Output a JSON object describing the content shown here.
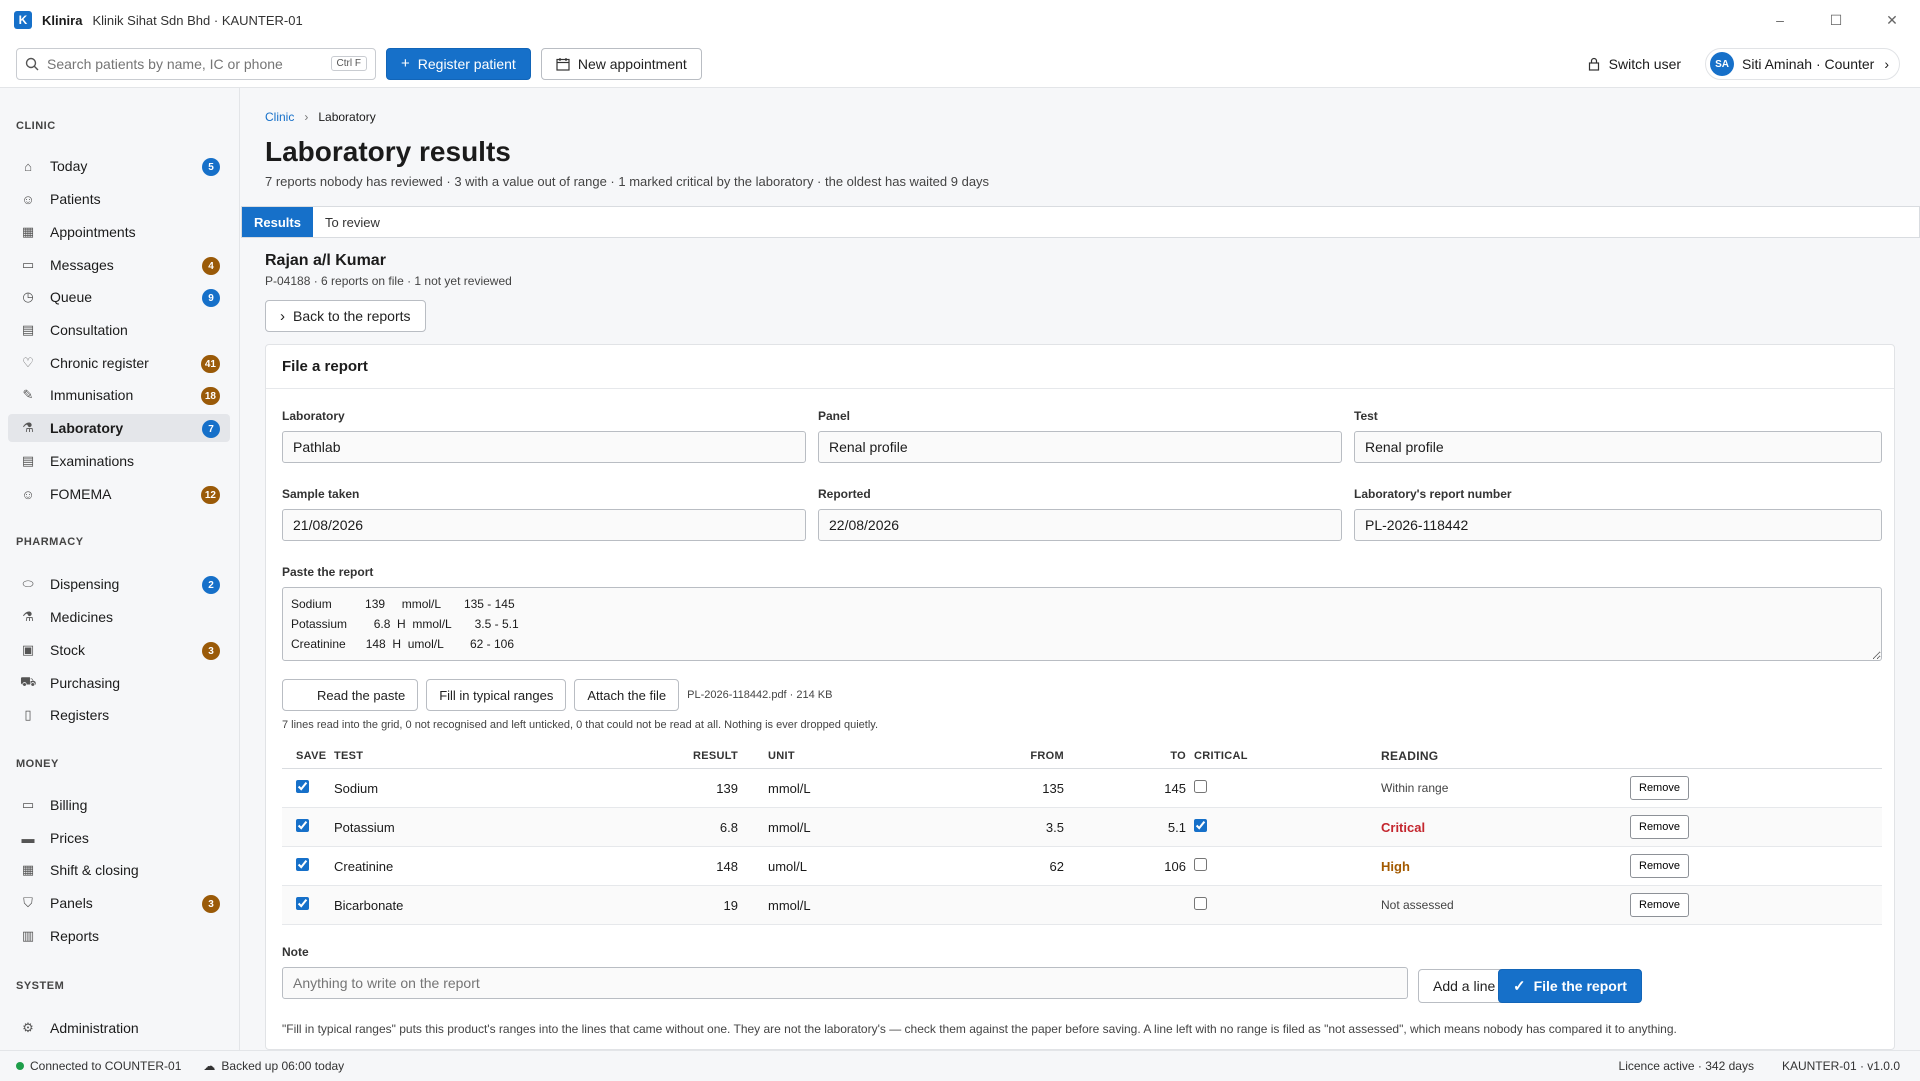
{
  "app": {
    "logo_letter": "K",
    "name": "Klinira",
    "context": "Klinik Sihat Sdn Bhd · KAUNTER-01",
    "window_controls": [
      "–",
      "☐",
      "✕"
    ]
  },
  "toolbar": {
    "search_placeholder": "Search patients by name, IC or phone",
    "search_shortcut": "Ctrl F",
    "register_label": "Register patient",
    "appointment_label": "New appointment",
    "switch_user_label": "Switch user",
    "user_initials": "SA",
    "user_label": "Siti Aminah · Counter"
  },
  "sidebar": {
    "sections": {
      "clinic": "CLINIC",
      "pharmacy": "PHARMACY",
      "money": "MONEY",
      "system": "SYSTEM"
    },
    "items": [
      {
        "label": "Today",
        "icon": "home-icon",
        "badge": "5",
        "badge_color": "blue"
      },
      {
        "label": "Patients",
        "icon": "people-icon",
        "badge": "",
        "badge_color": ""
      },
      {
        "label": "Appointments",
        "icon": "calendar-icon",
        "badge": "",
        "badge_color": ""
      },
      {
        "label": "Messages",
        "icon": "chat-icon",
        "badge": "4",
        "badge_color": "brown"
      },
      {
        "label": "Queue",
        "icon": "clock-icon",
        "badge": "9",
        "badge_color": "blue"
      },
      {
        "label": "Consultation",
        "icon": "document-icon",
        "badge": "",
        "badge_color": ""
      },
      {
        "label": "Chronic register",
        "icon": "heart-icon",
        "badge": "41",
        "badge_color": "brown"
      },
      {
        "label": "Immunisation",
        "icon": "syringe-icon",
        "badge": "18",
        "badge_color": "brown"
      },
      {
        "label": "Laboratory",
        "icon": "flask-icon",
        "badge": "7",
        "badge_color": "blue",
        "active": true
      },
      {
        "label": "Examinations",
        "icon": "clipboard-icon",
        "badge": "",
        "badge_color": ""
      },
      {
        "label": "FOMEMA",
        "icon": "people-icon",
        "badge": "12",
        "badge_color": "brown"
      },
      {
        "label": "Dispensing",
        "icon": "pill-icon",
        "badge": "2",
        "badge_color": "blue"
      },
      {
        "label": "Medicines",
        "icon": "flask-icon",
        "badge": "",
        "badge_color": ""
      },
      {
        "label": "Stock",
        "icon": "box-icon",
        "badge": "3",
        "badge_color": "brown"
      },
      {
        "label": "Purchasing",
        "icon": "cart-icon",
        "badge": "",
        "badge_color": ""
      },
      {
        "label": "Registers",
        "icon": "book-icon",
        "badge": "",
        "badge_color": ""
      },
      {
        "label": "Billing",
        "icon": "money-icon",
        "badge": "",
        "badge_color": ""
      },
      {
        "label": "Prices",
        "icon": "tag-icon",
        "badge": "",
        "badge_color": ""
      },
      {
        "label": "Shift & closing",
        "icon": "register-icon",
        "badge": "",
        "badge_color": ""
      },
      {
        "label": "Panels",
        "icon": "shield-icon",
        "badge": "3",
        "badge_color": "brown"
      },
      {
        "label": "Reports",
        "icon": "bar-chart-icon",
        "badge": "",
        "badge_color": ""
      },
      {
        "label": "Administration",
        "icon": "gear-icon",
        "badge": "",
        "badge_color": ""
      }
    ]
  },
  "breadcrumb": {
    "root": "Clinic",
    "current": "Laboratory"
  },
  "page": {
    "title": "Laboratory results",
    "subtitle": "7 reports nobody has reviewed · 3 with a value out of range · 1 marked critical by the laboratory · the oldest has waited 9 days"
  },
  "tabs": [
    "Results",
    "To review"
  ],
  "patient": {
    "name": "Rajan a/l Kumar",
    "meta": "P-04188 · 6 reports on file · 1 not yet reviewed",
    "back_label": "Back to the reports"
  },
  "form": {
    "heading": "File a report",
    "laboratory_label": "Laboratory",
    "laboratory_value": "Pathlab",
    "panel_label": "Panel",
    "panel_value": "Renal profile",
    "test_label": "Test",
    "test_value": "Renal profile",
    "sample_label": "Sample taken",
    "sample_value": "21/08/2026",
    "reported_label": "Reported",
    "reported_value": "22/08/2026",
    "report_no_label": "Laboratory's report number",
    "report_no_value": "PL-2026-118442",
    "paste_label": "Paste the report",
    "paste_value": "Sodium          139     mmol/L       135 - 145\nPotassium        6.8  H  mmol/L       3.5 - 5.1\nCreatinine      148  H  umol/L        62 - 106",
    "read_paste_label": "Read the paste",
    "fill_ranges_label": "Fill in typical ranges",
    "attach_label": "Attach the file",
    "attached_file": "PL-2026-118442.pdf · 214 KB",
    "parse_note": "7 lines read into the grid, 0 not recognised and left unticked, 0 that could not be read at all. Nothing is ever dropped quietly.",
    "note_label": "Note",
    "note_placeholder": "Anything to write on the report",
    "add_line_label": "Add a line",
    "file_report_label": "File the report",
    "foot_note": "\"Fill in typical ranges\" puts this product's ranges into the lines that came without one. They are not the laboratory's — check them against the paper before saving. A line left with no range is filed as \"not assessed\", which means nobody has compared it to anything."
  },
  "grid": {
    "headers": {
      "save": "SAVE",
      "test": "TEST",
      "result": "RESULT",
      "unit": "UNIT",
      "from": "FROM",
      "to": "TO",
      "critical": "CRITICAL",
      "reading": "READING"
    },
    "remove_label": "Remove",
    "rows": [
      {
        "save": true,
        "test": "Sodium",
        "result": "139",
        "unit": "mmol/L",
        "from": "135",
        "to": "145",
        "critical": false,
        "reading": "Within range",
        "reading_kind": "muted"
      },
      {
        "save": true,
        "test": "Potassium",
        "result": "6.8",
        "unit": "mmol/L",
        "from": "3.5",
        "to": "5.1",
        "critical": true,
        "reading": "Critical",
        "reading_kind": "critical"
      },
      {
        "save": true,
        "test": "Creatinine",
        "result": "148",
        "unit": "umol/L",
        "from": "62",
        "to": "106",
        "critical": false,
        "reading": "High",
        "reading_kind": "high"
      },
      {
        "save": true,
        "test": "Bicarbonate",
        "result": "19",
        "unit": "mmol/L",
        "from": "",
        "to": "",
        "critical": false,
        "reading": "Not assessed",
        "reading_kind": "muted"
      }
    ]
  },
  "statusbar": {
    "connection": "Connected to COUNTER-01",
    "backup": "Backed up 06:00 today",
    "licence": "Licence active · 342 days",
    "version": "KAUNTER-01 · v1.0.0"
  },
  "colors": {
    "accent": "#1670c9",
    "critical": "#c4262e",
    "high": "#a35a00",
    "badge_brown": "#9a5a08",
    "online": "#1e9e4a"
  }
}
